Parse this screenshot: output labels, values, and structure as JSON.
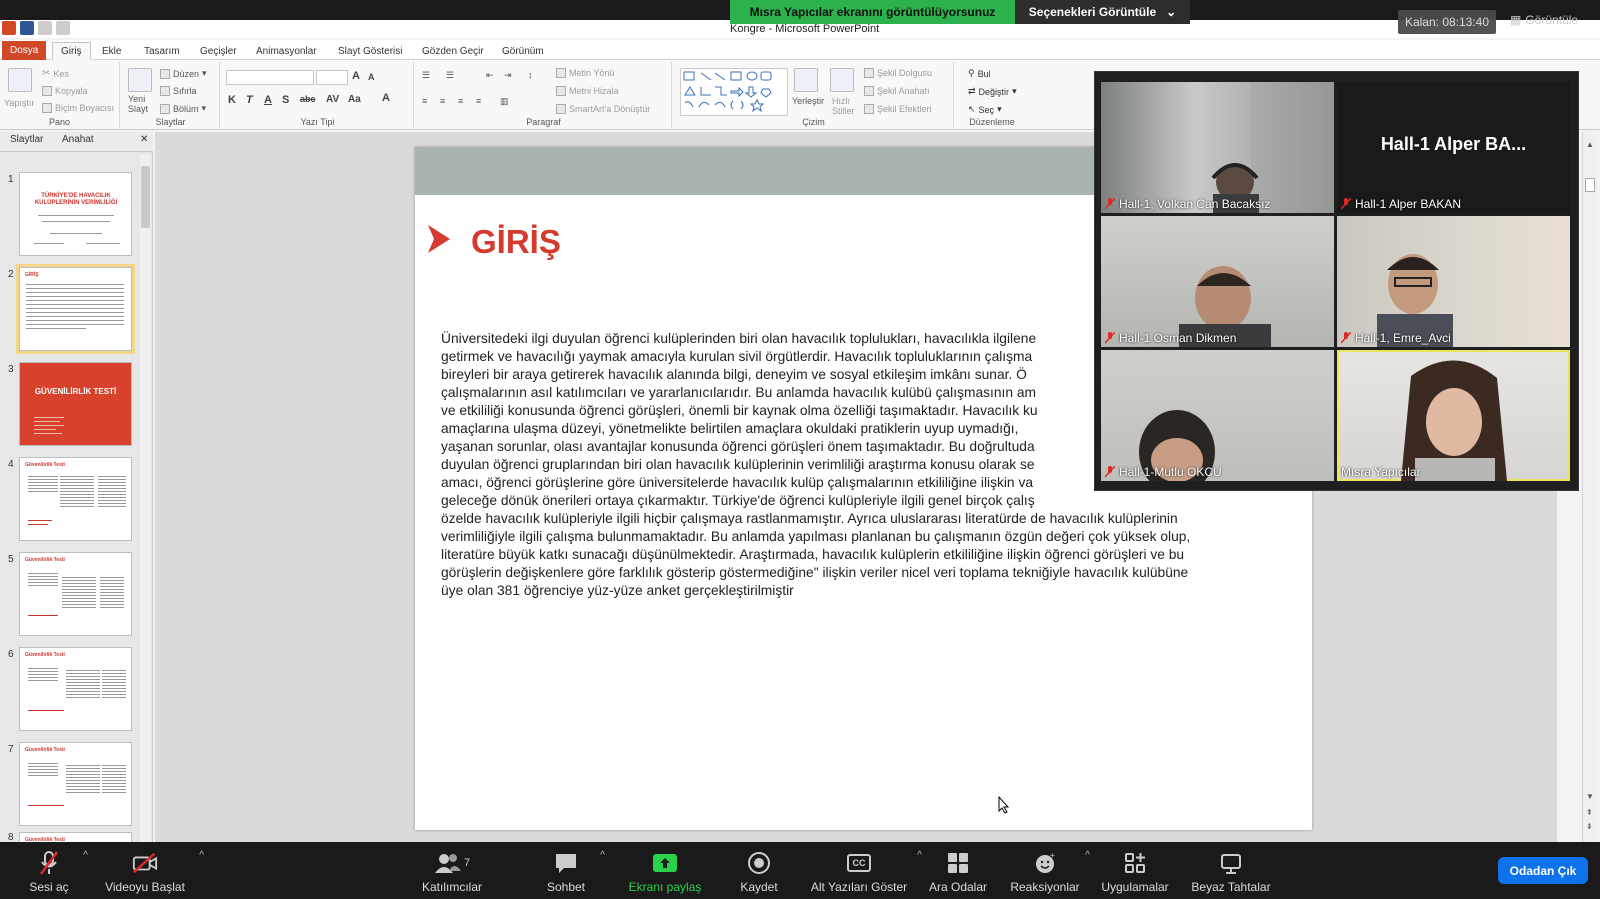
{
  "zoom": {
    "share_banner": "Mısra Yapıcılar ekranını görüntülüyorsunuz",
    "view_options": "Seçenekleri Görüntüle",
    "remaining": "Kalan: 08:13:40",
    "view_button": "Görüntüle",
    "participants_count": "7",
    "toolbar": [
      {
        "label": "Sesi aç",
        "icon": "microphone-muted-icon"
      },
      {
        "label": "Videoyu Başlat",
        "icon": "video-off-icon"
      },
      {
        "label": "Katılımcılar",
        "icon": "participants-icon"
      },
      {
        "label": "Sohbet",
        "icon": "chat-icon"
      },
      {
        "label": "Ekranı paylaş",
        "icon": "share-screen-icon"
      },
      {
        "label": "Kaydet",
        "icon": "record-icon"
      },
      {
        "label": "Alt Yazıları Göster",
        "icon": "closed-captions-icon"
      },
      {
        "label": "Ara Odalar",
        "icon": "breakout-rooms-icon"
      },
      {
        "label": "Reaksiyonlar",
        "icon": "reactions-icon"
      },
      {
        "label": "Uygulamalar",
        "icon": "apps-icon"
      },
      {
        "label": "Beyaz Tahtalar",
        "icon": "whiteboard-icon"
      }
    ],
    "cc_text": "CC",
    "leave_button": "Odadan Çık",
    "participants": [
      {
        "name": "Hall-1, Volkan Can Bacaksız"
      },
      {
        "name": "Hall-1 Alper BAKAN",
        "big_name": "Hall-1  Alper  BA..."
      },
      {
        "name": "Hall-1 Osman Dikmen"
      },
      {
        "name": "Hall-1, Emre_Avci"
      },
      {
        "name": "Hall-1-Mutlu OKCU"
      },
      {
        "name": "Mısra Yapıcılar"
      }
    ]
  },
  "powerpoint": {
    "window_title": "Kongre  -  Microsoft PowerPoint",
    "tabs": [
      "Dosya",
      "Giriş",
      "Ekle",
      "Tasarım",
      "Geçişler",
      "Animasyonlar",
      "Slayt Gösterisi",
      "Gözden Geçir",
      "Görünüm"
    ],
    "ribbon": {
      "pano": {
        "label": "Pano",
        "paste": "Yapıştır",
        "cut": "Kes",
        "copy": "Kopyala",
        "format_painter": "Biçim Boyacısı"
      },
      "slaytlar": {
        "label": "Slaytlar",
        "new_slide": "Yeni\nSlayt",
        "layout": "Düzen",
        "reset": "Sıfırla",
        "section": "Bölüm"
      },
      "yazi_tipi": {
        "label": "Yazı Tipi"
      },
      "paragraf": {
        "label": "Paragraf",
        "text_direction": "Metin Yönü",
        "align_text": "Metni Hizala",
        "smartart": "SmartArt'a Dönüştür"
      },
      "cizim": {
        "label": "Çizim",
        "arrange": "Yerleştir",
        "quick_styles": "Hızlı\nStiller",
        "shape_fill": "Şekil Dolgusu",
        "shape_outline": "Şekil Anahatı",
        "shape_effects": "Şekil Efektleri"
      },
      "duzenleme": {
        "label": "Düzenleme",
        "find": "Bul",
        "replace": "Değiştir",
        "select": "Seç"
      }
    },
    "panel_tabs": [
      "Slaytlar",
      "Anahat"
    ],
    "thumbnails": [
      {
        "num": "1",
        "title": "TÜRKİYE'DE HAVACILIK KULÜPLERİNİN VERİMLİLİĞİ"
      },
      {
        "num": "2",
        "title": "GİRİŞ"
      },
      {
        "num": "3",
        "title": "GÜVENİLİRLİK TESTİ"
      },
      {
        "num": "4",
        "title": "Güvenilirlik Testi"
      },
      {
        "num": "5",
        "title": "Güvenilirlik Testi"
      },
      {
        "num": "6",
        "title": "Güvenilirlik Testi"
      },
      {
        "num": "7",
        "title": "Güvenilirlik Testi"
      },
      {
        "num": "8",
        "title": "Güvenilirlik Testi"
      }
    ],
    "slide": {
      "title": "GİRİŞ",
      "body": "Üniversitedeki ilgi duyulan öğrenci kulüplerinden biri olan havacılık toplulukları, havacılıkla ilgilene\ngetirmek ve havacılığı yaymak amacıyla kurulan sivil örgütlerdir. Havacılık topluluklarının çalışma\nbireyleri bir araya getirerek havacılık alanında bilgi, deneyim ve sosyal etkileşim imkânı sunar. Ö\nçalışmalarının asıl katılımcıları ve yararlanıcılarıdır. Bu anlamda havacılık kulübü çalışmasının am\nve etkililiği konusunda öğrenci görüşleri, önemli bir kaynak olma özelliği taşımaktadır. Havacılık ku\namaçlarına ulaşma düzeyi, yönetmelikte belirtilen amaçlara okuldaki pratiklerin uyup uymadığı,\nyaşanan sorunlar, olası avantajlar konusunda öğrenci görüşleri önem taşımaktadır. Bu doğrultuda\nduyulan öğrenci gruplarından biri olan havacılık kulüplerinin verimliliği araştırma konusu olarak se\namacı, öğrenci görüşlerine göre üniversitelerde havacılık kulüp çalışmalarının etkililiğine ilişkin va\ngeleceğe dönük önerileri ortaya çıkarmaktır. Türkiye'de öğrenci kulüpleriyle ilgili genel birçok çalış\nözelde havacılık kulüpleriyle ilgili hiçbir çalışmaya rastlanmamıştır. Ayrıca uluslararası literatürde de havacılık kulüplerinin\nverimliliğiyle ilgili çalışma bulunmamaktadır. Bu anlamda yapılması planlanan bu çalışmanın özgün değeri çok yüksek olup,\nliteratüre büyük katkı sunacağı düşünülmektedir. Araştırmada, havacılık kulüplerin etkililiğine ilişkin öğrenci görüşleri ve bu\ngörüşlerin değişkenlere göre farklılık gösterip göstermediğine\" ilişkin veriler nicel veri toplama tekniğiyle havacılık kulübüne\nüye olan 381 öğrenciye yüz-yüze  anket gerçekleştirilmiştir"
    }
  }
}
